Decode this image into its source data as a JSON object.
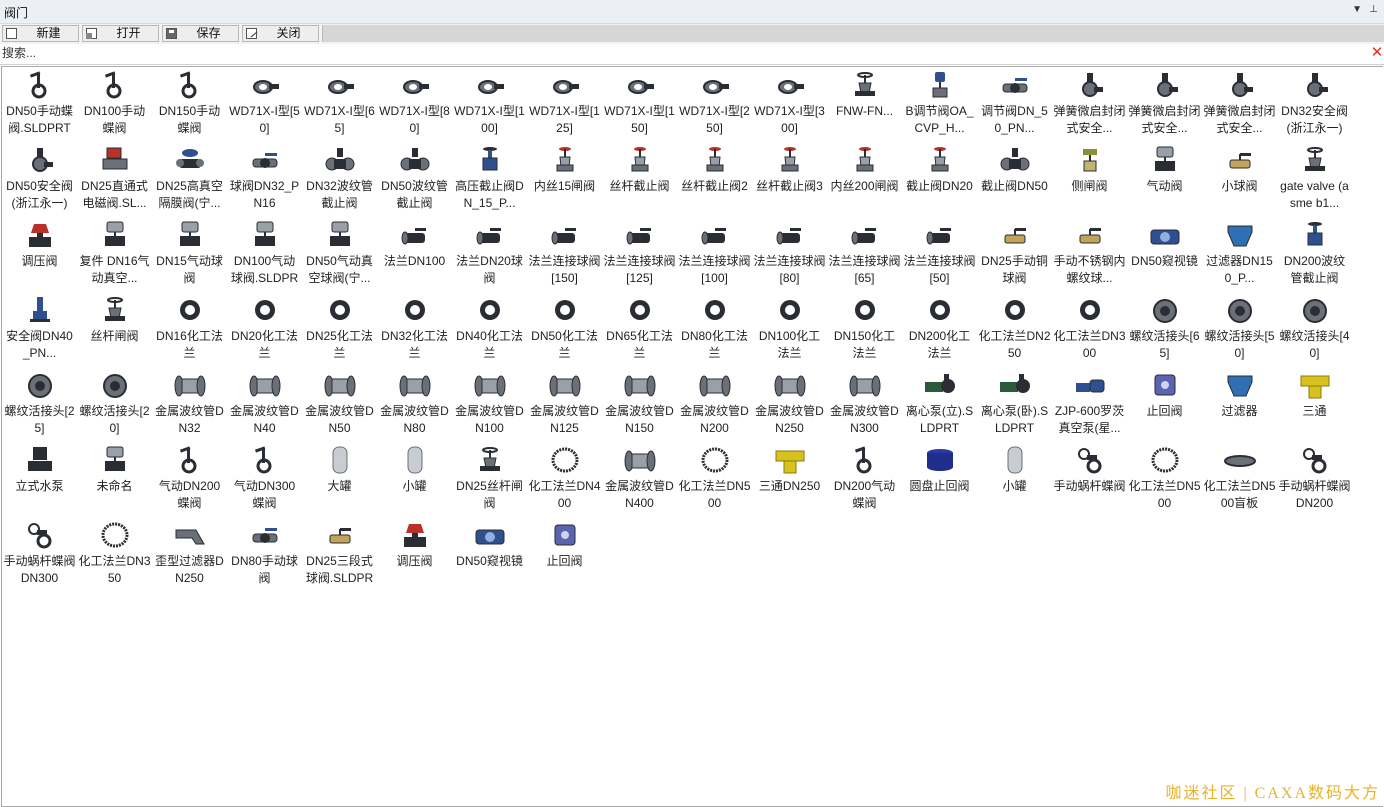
{
  "window": {
    "title": "阀门"
  },
  "toolbar": {
    "new_label": "新建",
    "open_label": "打开",
    "save_label": "保存",
    "close_label": "关闭"
  },
  "search": {
    "placeholder": "搜索..."
  },
  "watermark": "咖迷社区 | CAXA数码大方",
  "items": [
    {
      "label": "DN50手动蝶阀.SLDPRT",
      "icon": "butterfly-valve"
    },
    {
      "label": "DN100手动蝶阀",
      "icon": "butterfly-valve"
    },
    {
      "label": "DN150手动蝶阀",
      "icon": "butterfly-valve"
    },
    {
      "label": "WD71X-I型[50]",
      "icon": "wafer-valve"
    },
    {
      "label": "WD71X-I型[65]",
      "icon": "wafer-valve"
    },
    {
      "label": "WD71X-I型[80]",
      "icon": "wafer-valve"
    },
    {
      "label": "WD71X-I型[100]",
      "icon": "wafer-valve"
    },
    {
      "label": "WD71X-I型[125]",
      "icon": "wafer-valve"
    },
    {
      "label": "WD71X-I型[150]",
      "icon": "wafer-valve"
    },
    {
      "label": "WD71X-I型[250]",
      "icon": "wafer-valve"
    },
    {
      "label": "WD71X-I型[300]",
      "icon": "wafer-valve"
    },
    {
      "label": "FNW-FN...",
      "icon": "gate-valve"
    },
    {
      "label": "B调节阀OA_CVP_H...",
      "icon": "control-valve"
    },
    {
      "label": "调节阀DN_50_PN...",
      "icon": "ball-valve"
    },
    {
      "label": "弹簧微启封闭式安全...",
      "icon": "safety-valve"
    },
    {
      "label": "弹簧微启封闭式安全...",
      "icon": "safety-valve"
    },
    {
      "label": "弹簧微启封闭式安全...",
      "icon": "safety-valve"
    },
    {
      "label": "DN32安全阀(浙江永一)",
      "icon": "safety-valve"
    },
    {
      "label": "DN50安全阀(浙江永一)",
      "icon": "safety-valve"
    },
    {
      "label": "DN25直通式电磁阀.SL...",
      "icon": "solenoid-valve"
    },
    {
      "label": "DN25高真空隔膜阀(宁...",
      "icon": "diaphragm-valve"
    },
    {
      "label": "球阀DN32_PN16",
      "icon": "ball-valve"
    },
    {
      "label": "DN32波纹管截止阀",
      "icon": "bellows-valve"
    },
    {
      "label": "DN50波纹管截止阀",
      "icon": "bellows-valve"
    },
    {
      "label": "高压截止阀DN_15_P...",
      "icon": "globe-valve"
    },
    {
      "label": "内丝15闸阀",
      "icon": "gate-valve-red"
    },
    {
      "label": "丝杆截止阀",
      "icon": "gate-valve-red"
    },
    {
      "label": "丝杆截止阀2",
      "icon": "gate-valve-red"
    },
    {
      "label": "丝杆截止阀3",
      "icon": "gate-valve-red"
    },
    {
      "label": "内丝200闸阀",
      "icon": "gate-valve-red"
    },
    {
      "label": "截止阀DN20",
      "icon": "gate-valve-red"
    },
    {
      "label": "截止阀DN50",
      "icon": "bellows-valve"
    },
    {
      "label": "侧闸阀",
      "icon": "side-valve"
    },
    {
      "label": "气动阀",
      "icon": "pneumatic-valve"
    },
    {
      "label": "小球阀",
      "icon": "small-ball-valve"
    },
    {
      "label": "gate valve (asme b1...",
      "icon": "gate-valve"
    },
    {
      "label": "调压阀",
      "icon": "regulator-valve"
    },
    {
      "label": "复件 DN16气动真空...",
      "icon": "pneumatic-valve"
    },
    {
      "label": "DN15气动球阀",
      "icon": "pneumatic-valve"
    },
    {
      "label": "DN100气动球阀.SLDPRT",
      "icon": "pneumatic-valve"
    },
    {
      "label": "DN50气动真空球阀(宁...",
      "icon": "pneumatic-valve"
    },
    {
      "label": "法兰DN100",
      "icon": "flange-ball-valve"
    },
    {
      "label": "法兰DN20球阀",
      "icon": "flange-ball-valve"
    },
    {
      "label": "法兰连接球阀[150]",
      "icon": "flange-ball-valve"
    },
    {
      "label": "法兰连接球阀[125]",
      "icon": "flange-ball-valve"
    },
    {
      "label": "法兰连接球阀[100]",
      "icon": "flange-ball-valve"
    },
    {
      "label": "法兰连接球阀[80]",
      "icon": "flange-ball-valve"
    },
    {
      "label": "法兰连接球阀[65]",
      "icon": "flange-ball-valve"
    },
    {
      "label": "法兰连接球阀[50]",
      "icon": "flange-ball-valve"
    },
    {
      "label": "DN25手动铜球阀",
      "icon": "small-ball-valve"
    },
    {
      "label": "手动不锈钢内螺纹球...",
      "icon": "small-ball-valve"
    },
    {
      "label": "DN50窥视镜",
      "icon": "sight-glass"
    },
    {
      "label": "过滤器DN150_P...",
      "icon": "filter"
    },
    {
      "label": "DN200波纹管截止阀",
      "icon": "globe-valve"
    },
    {
      "label": "安全阀DN40_PN...",
      "icon": "safety-valve-blue"
    },
    {
      "label": "丝杆闸阀",
      "icon": "gate-valve"
    },
    {
      "label": "DN16化工法兰",
      "icon": "flange"
    },
    {
      "label": "DN20化工法兰",
      "icon": "flange"
    },
    {
      "label": "DN25化工法兰",
      "icon": "flange"
    },
    {
      "label": "DN32化工法兰",
      "icon": "flange"
    },
    {
      "label": "DN40化工法兰",
      "icon": "flange"
    },
    {
      "label": "DN50化工法兰",
      "icon": "flange"
    },
    {
      "label": "DN65化工法兰",
      "icon": "flange"
    },
    {
      "label": "DN80化工法兰",
      "icon": "flange"
    },
    {
      "label": "DN100化工法兰",
      "icon": "flange"
    },
    {
      "label": "DN150化工法兰",
      "icon": "flange"
    },
    {
      "label": "DN200化工法兰",
      "icon": "flange"
    },
    {
      "label": "化工法兰DN250",
      "icon": "flange"
    },
    {
      "label": "化工法兰DN300",
      "icon": "flange"
    },
    {
      "label": "螺纹活接头[65]",
      "icon": "union"
    },
    {
      "label": "螺纹活接头[50]",
      "icon": "union"
    },
    {
      "label": "螺纹活接头[40]",
      "icon": "union"
    },
    {
      "label": "螺纹活接头[25]",
      "icon": "union"
    },
    {
      "label": "螺纹活接头[20]",
      "icon": "union"
    },
    {
      "label": "金属波纹管DN32",
      "icon": "bellows"
    },
    {
      "label": "金属波纹管DN40",
      "icon": "bellows"
    },
    {
      "label": "金属波纹管DN50",
      "icon": "bellows"
    },
    {
      "label": "金属波纹管DN80",
      "icon": "bellows"
    },
    {
      "label": "金属波纹管DN100",
      "icon": "bellows"
    },
    {
      "label": "金属波纹管DN125",
      "icon": "bellows"
    },
    {
      "label": "金属波纹管DN150",
      "icon": "bellows"
    },
    {
      "label": "金属波纹管DN200",
      "icon": "bellows"
    },
    {
      "label": "金属波纹管DN250",
      "icon": "bellows"
    },
    {
      "label": "金属波纹管DN300",
      "icon": "bellows"
    },
    {
      "label": "离心泵(立).SLDPRT",
      "icon": "pump"
    },
    {
      "label": "离心泵(卧).SLDPRT",
      "icon": "pump"
    },
    {
      "label": "ZJP-600罗茨真空泵(星...",
      "icon": "vacuum-pump"
    },
    {
      "label": "止回阀",
      "icon": "check-valve"
    },
    {
      "label": "过滤器",
      "icon": "filter"
    },
    {
      "label": "三通",
      "icon": "tee"
    },
    {
      "label": "立式水泵",
      "icon": "vertical-pump"
    },
    {
      "label": "未命名",
      "icon": "pneumatic-valve"
    },
    {
      "label": "气动DN200蝶阀",
      "icon": "butterfly-valve"
    },
    {
      "label": "气动DN300蝶阀",
      "icon": "butterfly-valve"
    },
    {
      "label": "大罐",
      "icon": "tank"
    },
    {
      "label": "小罐",
      "icon": "tank"
    },
    {
      "label": "DN25丝杆闸阀",
      "icon": "gate-valve"
    },
    {
      "label": "化工法兰DN400",
      "icon": "ring"
    },
    {
      "label": "金属波纹管DN400",
      "icon": "bellows"
    },
    {
      "label": "化工法兰DN500",
      "icon": "ring"
    },
    {
      "label": "三通DN250",
      "icon": "tee"
    },
    {
      "label": "DN200气动蝶阀",
      "icon": "butterfly-valve"
    },
    {
      "label": "圆盘止回阀",
      "icon": "disc-check-valve"
    },
    {
      "label": "小罐",
      "icon": "tank"
    },
    {
      "label": "手动蜗杆蝶阀",
      "icon": "worm-butterfly-valve"
    },
    {
      "label": "化工法兰DN500",
      "icon": "ring"
    },
    {
      "label": "化工法兰DN500盲板",
      "icon": "blind-flange"
    },
    {
      "label": "手动蜗杆蝶阀DN200",
      "icon": "worm-butterfly-valve"
    },
    {
      "label": "手动蜗杆蝶阀DN300",
      "icon": "worm-butterfly-valve"
    },
    {
      "label": "化工法兰DN350",
      "icon": "ring"
    },
    {
      "label": "歪型过滤器DN250",
      "icon": "y-strainer"
    },
    {
      "label": "DN80手动球阀",
      "icon": "ball-valve"
    },
    {
      "label": "DN25三段式球阀.SLDPRT",
      "icon": "small-ball-valve"
    },
    {
      "label": "调压阀",
      "icon": "regulator-valve"
    },
    {
      "label": "DN50窥视镜",
      "icon": "sight-glass"
    },
    {
      "label": "止回阀",
      "icon": "check-valve"
    }
  ]
}
